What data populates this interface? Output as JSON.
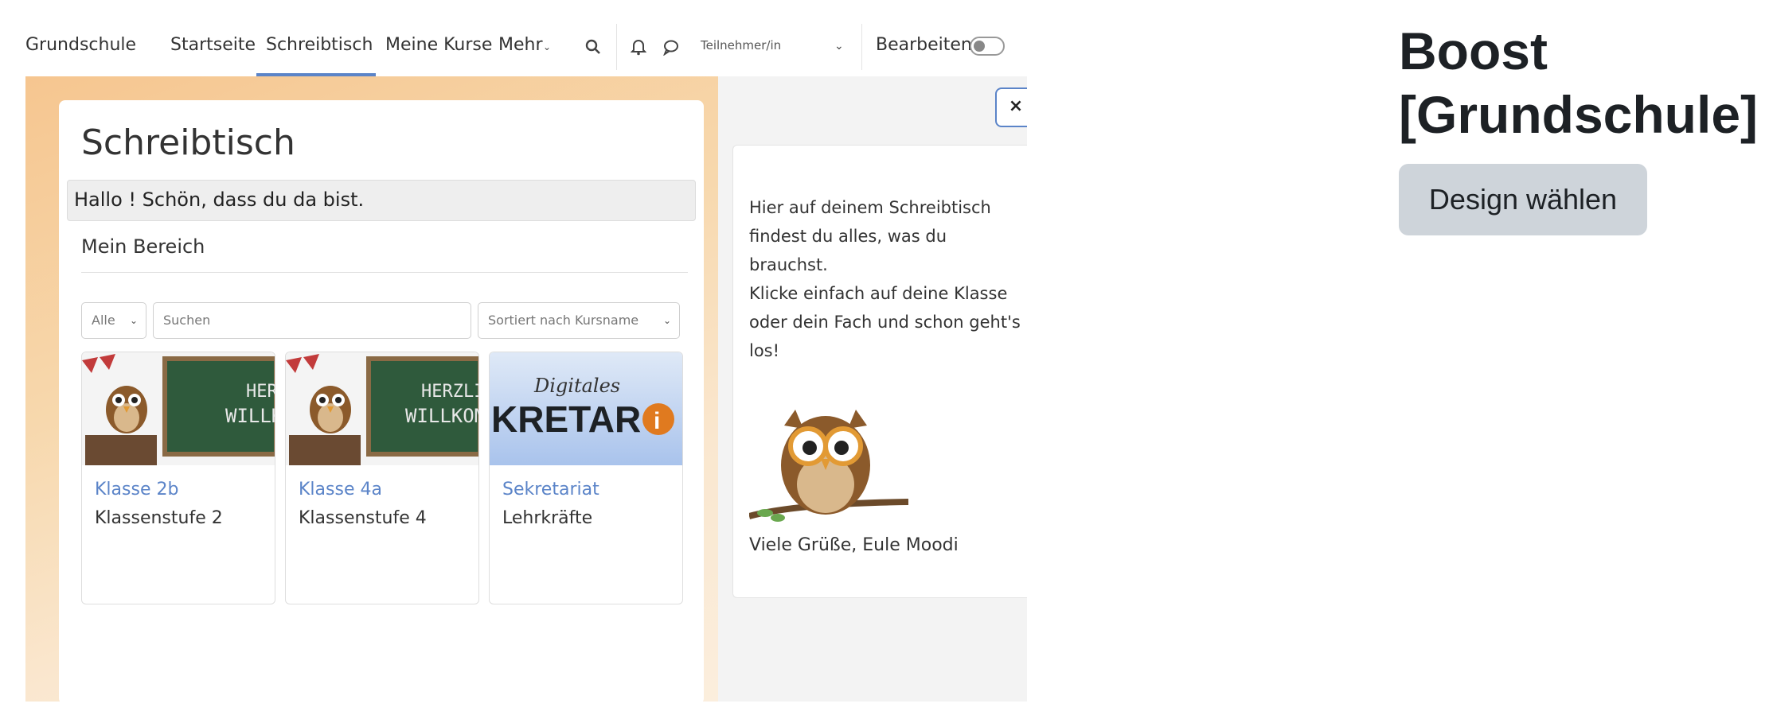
{
  "navbar": {
    "brand": "Grundschule",
    "items": [
      "Startseite",
      "Schreibtisch",
      "Meine Kurse",
      "Mehr"
    ],
    "role": "Teilnehmer/in",
    "edit_label": "Bearbeiten"
  },
  "main": {
    "title": "Schreibtisch",
    "greeting": "Hallo           ! Schön, dass du da bist.",
    "section": "Mein Bereich",
    "filter_all": "Alle",
    "search_placeholder": "Suchen",
    "sort_label": "Sortiert nach Kursname",
    "courses": [
      {
        "name": "Klasse 2b",
        "category": "Klassenstufe 2",
        "banner_top": "HERZLI",
        "banner_bottom": "WILLKOM"
      },
      {
        "name": "Klasse 4a",
        "category": "Klassenstufe 4",
        "banner_top": "HERZLI",
        "banner_bottom": "WILLKOM"
      },
      {
        "name": "Sekretariat",
        "category": "Lehrkräfte",
        "banner_top": "Digitales",
        "banner_bottom": "KRETAR"
      }
    ]
  },
  "sidebar_panel": {
    "close_glyph": "×",
    "text_lines": [
      "Hier auf deinem Schreibtisch",
      "findest du alles, was du",
      "brauchst.",
      "Klicke einfach auf deine Klasse",
      "oder dein Fach und schon geht's",
      "los!"
    ],
    "signature": "Viele Grüße, Eule Moodi"
  },
  "theme": {
    "title": "Boost [Grundschule]",
    "button_label": "Design wählen"
  },
  "icons": {
    "search": "search-icon",
    "bell": "bell-icon",
    "chat": "chat-icon",
    "dropdown": "chevron-down-icon",
    "close": "close-icon"
  },
  "colors": {
    "accent": "#5b84c8",
    "button_bg": "#ced4da",
    "bg_warm": "#f6c690"
  }
}
